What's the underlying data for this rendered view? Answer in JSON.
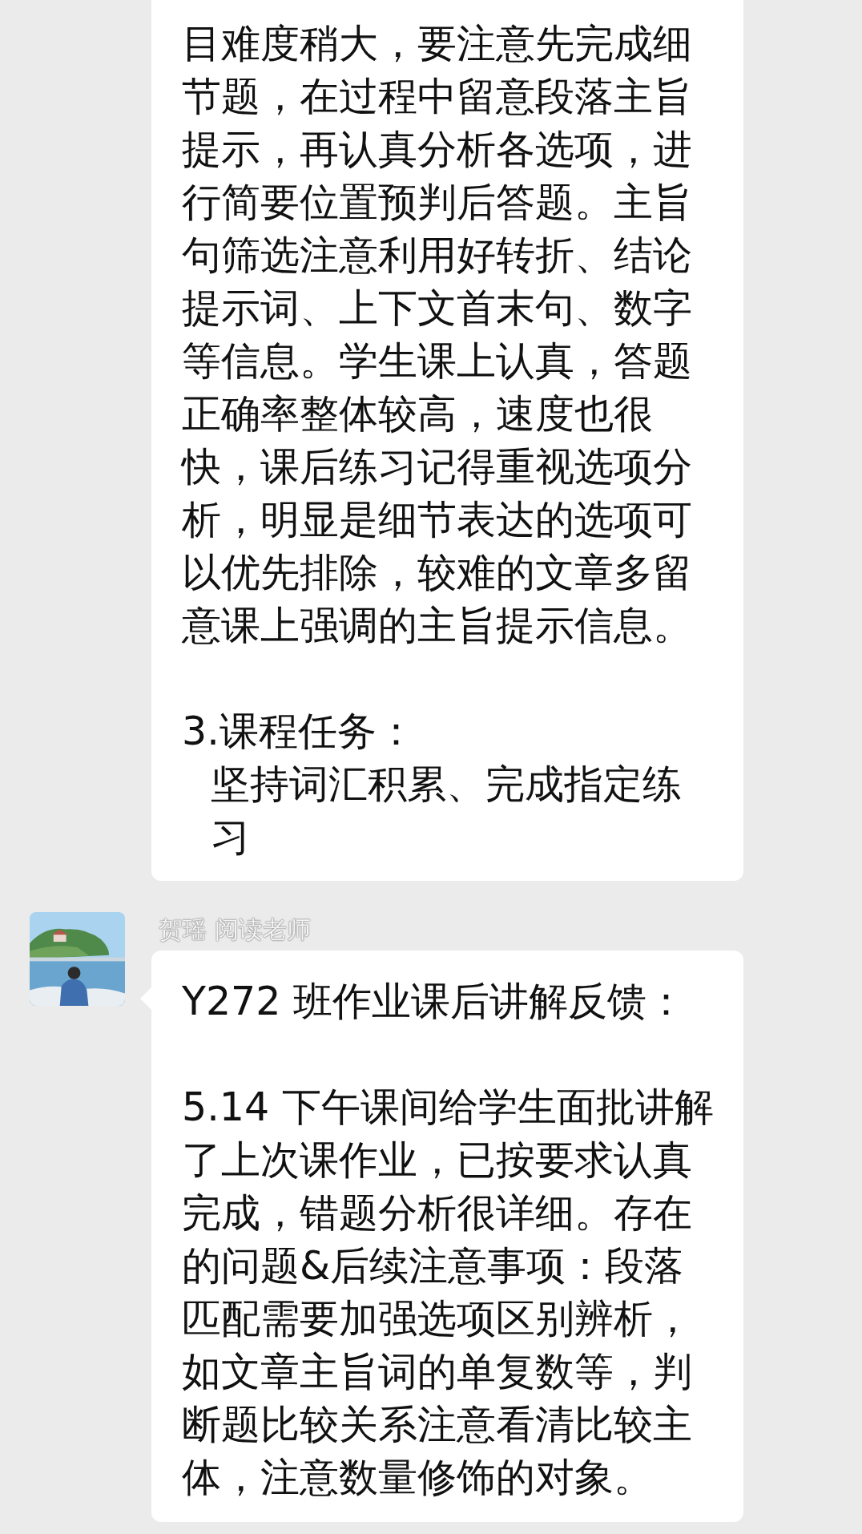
{
  "messages": [
    {
      "kind": "text",
      "paragraphs": [
        "目难度稍大，要注意先完成细节题，在过程中留意段落主旨提示，再认真分析各选项，进行简要位置预判后答题。主旨句筛选注意利用好转折、结论提示词、上下文首末句、数字等信息。学生课上认真，答题正确率整体较高，速度也很快，课后练习记得重视选项分析，明显是细节表达的选项可以优先排除，较难的文章多留意课上强调的主旨提示信息。",
        "3.课程任务："
      ],
      "indented_lines": [
        "坚持词汇积累、完成指定练习"
      ]
    },
    {
      "kind": "text",
      "sender": "贺瑶 阅读老师",
      "paragraphs": [
        "Y272 班作业课后讲解反馈：",
        "5.14 下午课间给学生面批讲解了上次课作业，已按要求认真完成，错题分析很详细。存在的问题&后续注意事项：段落匹配需要加强选项区别辨析，如文章主旨词的单复数等，判断题比较关系注意看清比较主体，注意数量修饰的对象。"
      ]
    }
  ]
}
